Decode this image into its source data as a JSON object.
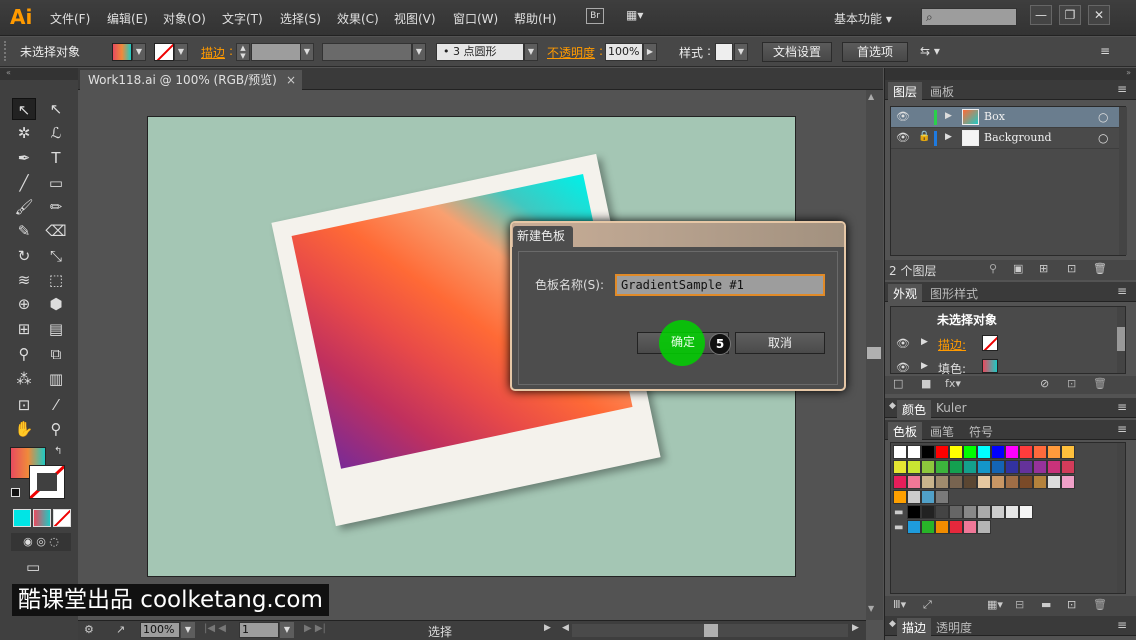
{
  "app": {
    "logo": "Ai",
    "workspace": "基本功能",
    "bridge": "Br"
  },
  "menu": [
    "文件(F)",
    "编辑(E)",
    "对象(O)",
    "文字(T)",
    "选择(S)",
    "效果(C)",
    "视图(V)",
    "窗口(W)",
    "帮助(H)"
  ],
  "window_buttons": [
    "—",
    "❐",
    "✕"
  ],
  "control_bar": {
    "selection": "未选择对象",
    "stroke_label": "描边",
    "brush": "3 点圆形",
    "opacity_label": "不透明度",
    "opacity_value": "100%",
    "style_label": "样式",
    "doc_setup": "文档设置",
    "preferences": "首选项"
  },
  "document": {
    "tab": "Work118.ai @ 100% (RGB/预览)",
    "zoom": "100%",
    "artboard_num": "1",
    "status": "选择"
  },
  "layers_panel": {
    "tabs": [
      "图层",
      "画板"
    ],
    "layers": [
      {
        "name": "Box",
        "color": "#2ad04a"
      },
      {
        "name": "Background",
        "color": "#1e7ae0"
      }
    ],
    "count": "2 个图层"
  },
  "appearance_panel": {
    "tabs": [
      "外观",
      "图形样式"
    ],
    "title": "未选择对象",
    "rows": [
      {
        "label": "描边:"
      },
      {
        "label": "填色:"
      }
    ]
  },
  "color_panel": {
    "tabs": [
      "颜色",
      "Kuler"
    ]
  },
  "swatches_panel": {
    "tabs": [
      "色板",
      "画笔",
      "符号"
    ]
  },
  "bottom_panel": {
    "tabs": [
      "描边",
      "透明度"
    ]
  },
  "dialog": {
    "title": "新建色板",
    "field_label": "色板名称(S):",
    "field_value": "GradientSample #1",
    "ok": "确定",
    "cancel": "取消",
    "step_badge": "5"
  },
  "watermark": "酷课堂出品 coolketang.com",
  "colors": {
    "accent": "#ff9a00",
    "canvas": "#a4c6b4",
    "highlight": "#00d000"
  }
}
